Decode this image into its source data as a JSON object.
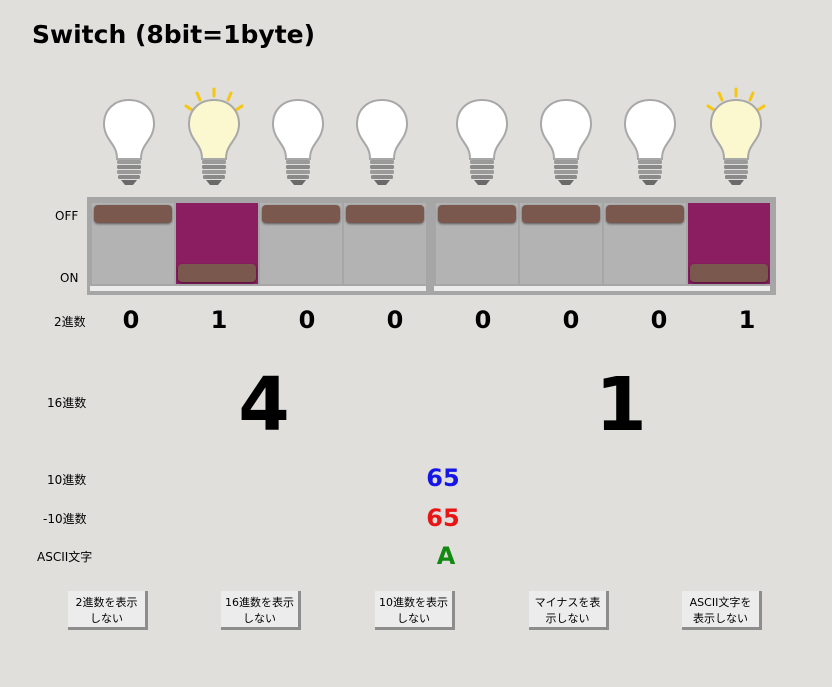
{
  "title": "Switch (8bit=1byte)",
  "labels": {
    "off": "OFF",
    "on": "ON",
    "binary": "2進数",
    "hex": "16進数",
    "decimal": "10進数",
    "signed_decimal": "-10進数",
    "ascii": "ASCII文字"
  },
  "bits": [
    "0",
    "1",
    "0",
    "0",
    "0",
    "0",
    "0",
    "1"
  ],
  "bit_states": [
    false,
    true,
    false,
    false,
    false,
    false,
    false,
    true
  ],
  "hex_digits": [
    "4",
    "1"
  ],
  "decimal_value": "65",
  "signed_decimal_value": "65",
  "ascii_value": "A",
  "colors": {
    "decimal": "#1515e8",
    "signed_decimal": "#e81515",
    "ascii": "#128a12",
    "switch_on": "#8a1e60",
    "switch_off": "#b3b3b3",
    "lever": "#7b584d"
  },
  "buttons": [
    "2進数を表示\nしない",
    "16進数を表示\nしない",
    "10進数を表示\nしない",
    "マイナスを表\n示しない",
    "ASCII文字を\n表示しない"
  ]
}
